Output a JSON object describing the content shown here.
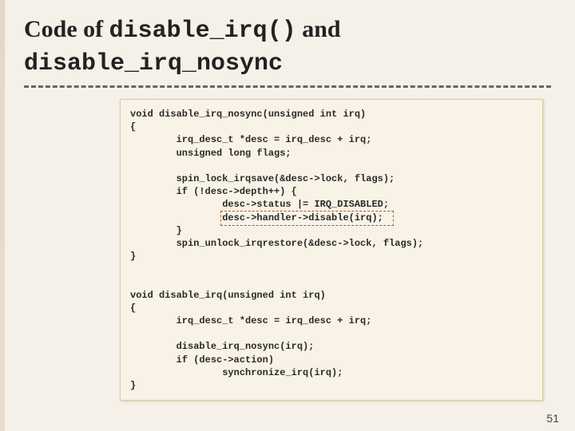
{
  "title": {
    "prefix": "Code of ",
    "mono1": "disable_irq()",
    "mid": " and ",
    "mono2": "disable_irq_nosync"
  },
  "code": "void disable_irq_nosync(unsigned int irq)\n{\n        irq_desc_t *desc = irq_desc + irq;\n        unsigned long flags;\n\n        spin_lock_irqsave(&desc->lock, flags);\n        if (!desc->depth++) {\n                desc->status |= IRQ_DISABLED;\n                desc->handler->disable(irq);\n        }\n        spin_unlock_irqrestore(&desc->lock, flags);\n}\n\n\nvoid disable_irq(unsigned int irq)\n{\n        irq_desc_t *desc = irq_desc + irq;\n\n        disable_irq_nosync(irq);\n        if (desc->action)\n                synchronize_irq(irq);\n}",
  "page_number": "51"
}
